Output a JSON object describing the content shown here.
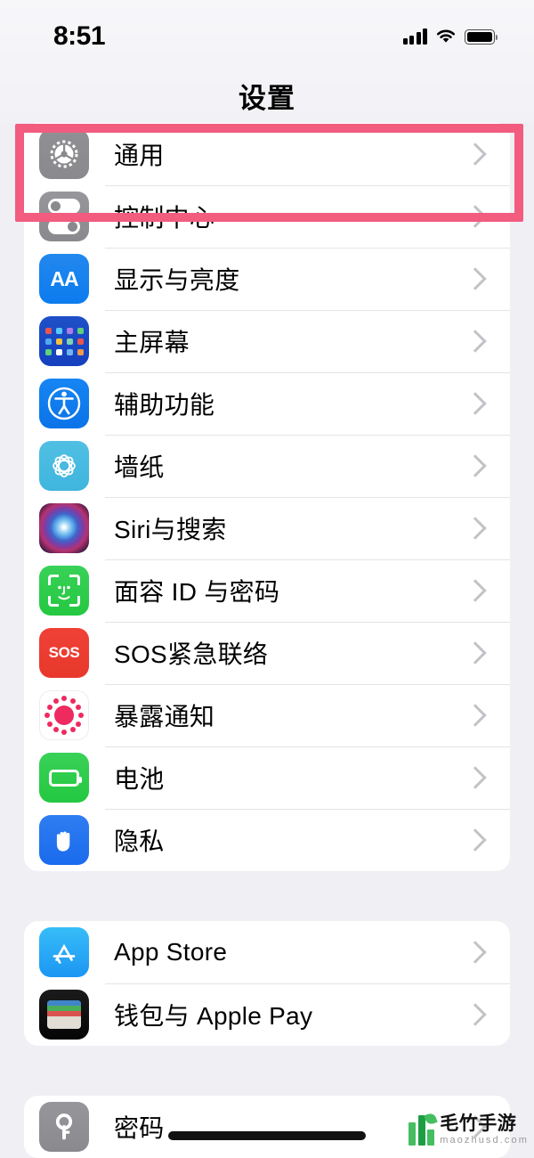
{
  "status_bar": {
    "time": "8:51",
    "signal_icon": "cellular-signal-icon",
    "wifi_icon": "wifi-icon",
    "battery_icon": "battery-full-icon"
  },
  "nav": {
    "title": "设置"
  },
  "highlight": {
    "color": "#F15C7F",
    "target_row": "通用"
  },
  "groups": [
    {
      "rows": [
        {
          "label": "通用",
          "icon": "gear-icon",
          "chevron": "chevron-right-icon"
        },
        {
          "label": "控制中心",
          "icon": "control-center-icon",
          "chevron": "chevron-right-icon"
        },
        {
          "label": "显示与亮度",
          "icon": "display-brightness-icon",
          "chevron": "chevron-right-icon"
        },
        {
          "label": "主屏幕",
          "icon": "home-screen-icon",
          "chevron": "chevron-right-icon"
        },
        {
          "label": "辅助功能",
          "icon": "accessibility-icon",
          "chevron": "chevron-right-icon"
        },
        {
          "label": "墙纸",
          "icon": "wallpaper-icon",
          "chevron": "chevron-right-icon"
        },
        {
          "label": "Siri与搜索",
          "icon": "siri-icon",
          "chevron": "chevron-right-icon"
        },
        {
          "label": "面容 ID 与密码",
          "icon": "face-id-icon",
          "chevron": "chevron-right-icon"
        },
        {
          "label": "SOS紧急联络",
          "icon": "emergency-sos-icon",
          "chevron": "chevron-right-icon"
        },
        {
          "label": "暴露通知",
          "icon": "exposure-notification-icon",
          "chevron": "chevron-right-icon"
        },
        {
          "label": "电池",
          "icon": "battery-icon",
          "chevron": "chevron-right-icon"
        },
        {
          "label": "隐私",
          "icon": "privacy-hand-icon",
          "chevron": "chevron-right-icon"
        }
      ]
    },
    {
      "rows": [
        {
          "label": "App Store",
          "icon": "app-store-icon",
          "chevron": "chevron-right-icon"
        },
        {
          "label": "钱包与 Apple Pay",
          "icon": "wallet-icon",
          "chevron": "chevron-right-icon"
        }
      ]
    },
    {
      "rows": [
        {
          "label": "密码",
          "icon": "passwords-key-icon",
          "chevron": "chevron-right-icon"
        }
      ]
    }
  ],
  "watermark": {
    "brand_cn": "毛竹手游",
    "brand_url": "maozhusd.com"
  },
  "icon_glyph_text": {
    "display": "AA",
    "sos": "SOS"
  }
}
